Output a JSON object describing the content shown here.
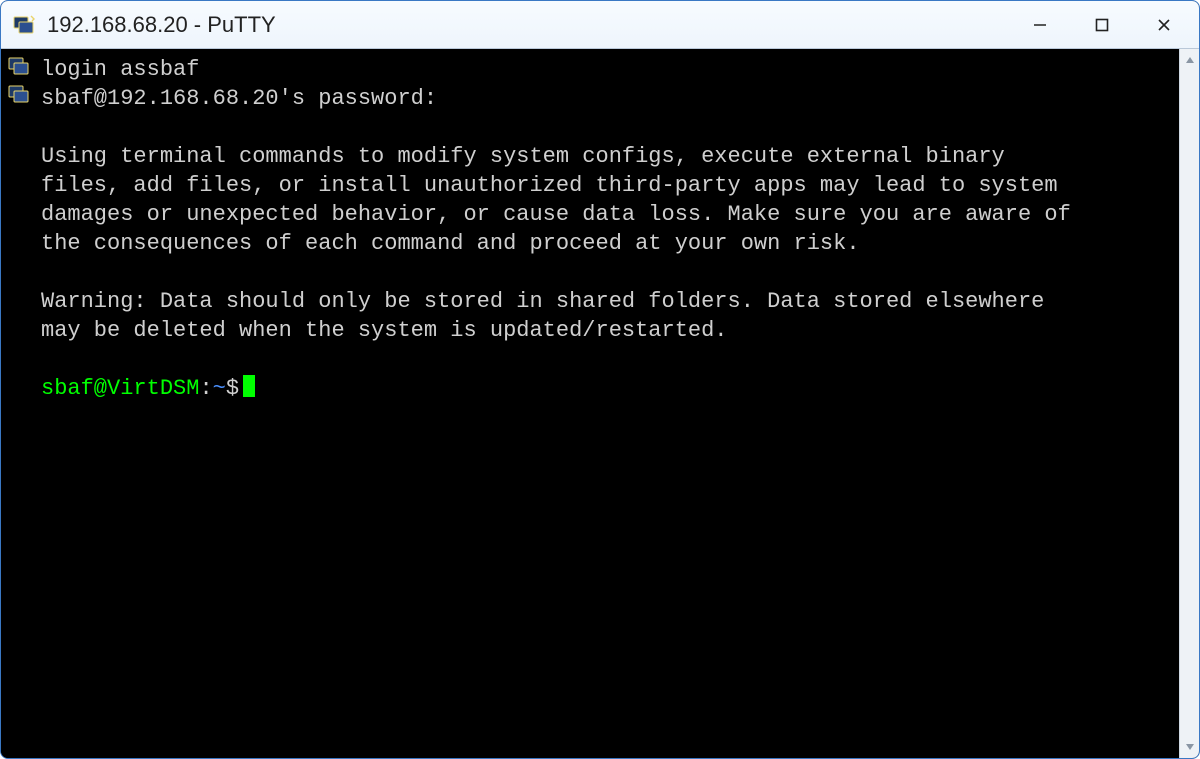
{
  "titlebar": {
    "title": "192.168.68.20 - PuTTY"
  },
  "terminal": {
    "login_line": "login assbaf",
    "password_line": "sbaf@192.168.68.20's password:",
    "motd_block1": "Using terminal commands to modify system configs, execute external binary \nfiles, add files, or install unauthorized third-party apps may lead to system \ndamages or unexpected behavior, or cause data loss. Make sure you are aware of \nthe consequences of each command and proceed at your own risk.",
    "motd_block2": "Warning: Data should only be stored in shared folders. Data stored elsewhere \nmay be deleted when the system is updated/restarted.",
    "prompt": {
      "user_host": "sbaf@VirtDSM",
      "sep": ":",
      "path": "~",
      "symbol": "$"
    }
  }
}
